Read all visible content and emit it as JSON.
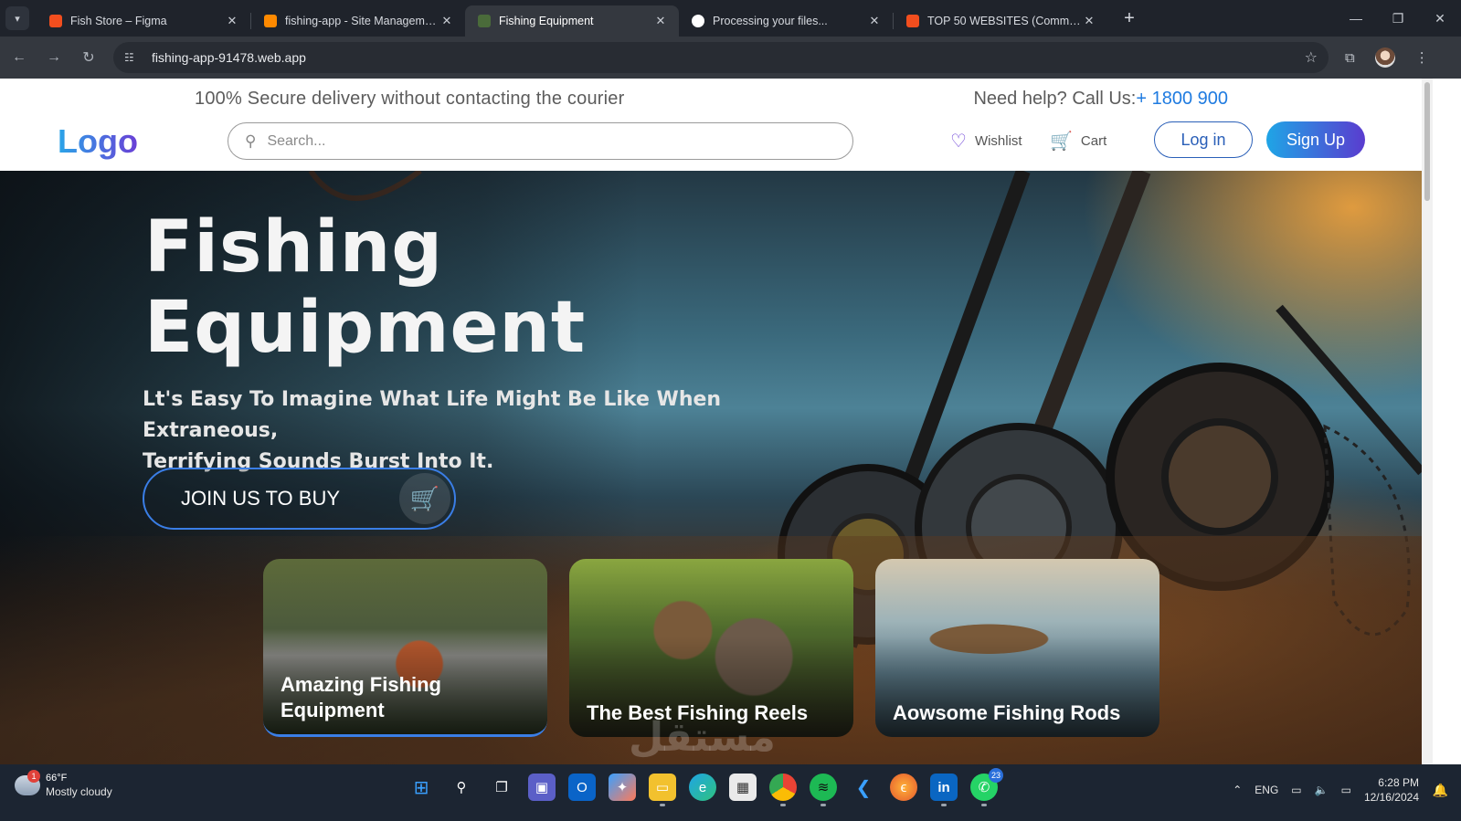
{
  "browser": {
    "tabs": [
      {
        "title": "Fish Store – Figma",
        "favicon_color": "#f24e1e",
        "active": false
      },
      {
        "title": "fishing-app - Site Management",
        "favicon_color": "#ff8a00",
        "active": false
      },
      {
        "title": "Fishing Equipment",
        "favicon_color": "#4a6b3a",
        "active": true
      },
      {
        "title": "Processing your files...",
        "favicon_color": "#ffffff",
        "active": false
      },
      {
        "title": "TOP 50 WEBSITES (Community)",
        "favicon_color": "#f24e1e",
        "active": false
      }
    ],
    "url": "fishing-app-91478.web.app"
  },
  "topline": {
    "delivery": "100% Secure delivery without contacting the courier",
    "help_prefix": "Need help? Call Us:",
    "phone": "+ 1800 900"
  },
  "header": {
    "logo": "Logo",
    "search_placeholder": "Search...",
    "wishlist": "Wishlist",
    "cart": "Cart",
    "login": "Log in",
    "signup": "Sign Up"
  },
  "hero": {
    "title_line1": "Fishing",
    "title_line2": "Equipment",
    "subtitle_line1": "Lt's Easy To Imagine What Life Might Be Like When Extraneous,",
    "subtitle_line2": "Terrifying Sounds Burst Into It.",
    "cta": "JOIN US TO BUY"
  },
  "cards": [
    {
      "label": "Amazing Fishing Equipment"
    },
    {
      "label": "The Best Fishing Reels"
    },
    {
      "label": "Aowsome Fishing Rods"
    }
  ],
  "taskbar": {
    "temp": "66°F",
    "condition": "Mostly cloudy",
    "weather_badge": "1",
    "whatsapp_badge": "23",
    "language": "ENG",
    "time": "6:28 PM",
    "date": "12/16/2024"
  },
  "watermark": "مستقل"
}
